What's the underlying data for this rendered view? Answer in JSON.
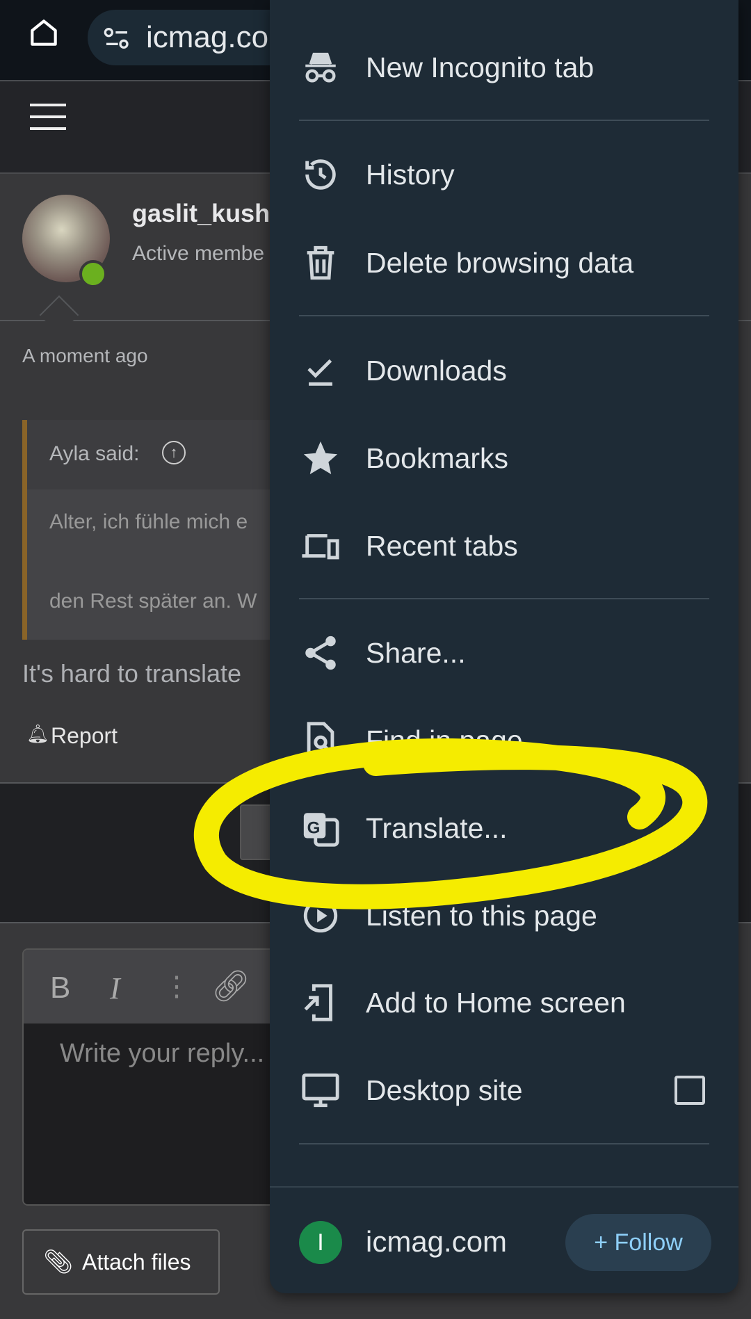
{
  "browser": {
    "url": "icmag.co",
    "home_icon": "home-icon",
    "site_settings_icon": "tune-icon"
  },
  "post": {
    "username": "gaslit_kush",
    "role": "Active membe",
    "time": "A moment ago",
    "quote_author": "Ayla said:",
    "quote_line1": "Alter, ich fühle mich e",
    "quote_line2": "den Rest später an. W",
    "body": "It's hard to translate ",
    "report": "Report",
    "quote_bar_color": "#8a6428",
    "online_color": "#6bb01f"
  },
  "editor": {
    "placeholder": "Write your reply...",
    "bold": "B",
    "italic": "I",
    "more": "⋮",
    "attach": "Attach files"
  },
  "menu": {
    "items": [
      {
        "label": "New Incognito tab",
        "icon": "incognito-icon"
      },
      {
        "label": "History",
        "icon": "history-icon"
      },
      {
        "label": "Delete browsing data",
        "icon": "trash-icon"
      },
      {
        "label": "Downloads",
        "icon": "download-done-icon"
      },
      {
        "label": "Bookmarks",
        "icon": "star-icon"
      },
      {
        "label": "Recent tabs",
        "icon": "devices-icon"
      },
      {
        "label": "Share...",
        "icon": "share-icon"
      },
      {
        "label": "Find in page",
        "icon": "find-in-page-icon"
      },
      {
        "label": "Translate...",
        "icon": "translate-icon"
      },
      {
        "label": "Listen to this page",
        "icon": "play-circle-icon"
      },
      {
        "label": "Add to Home screen",
        "icon": "add-to-home-icon"
      },
      {
        "label": "Desktop site",
        "icon": "monitor-icon",
        "checked": false
      }
    ],
    "footer": {
      "site": "icmag.com",
      "avatar_letter": "I",
      "follow": "Follow",
      "follow_plus": "+",
      "avatar_color": "#1a8a4a",
      "follow_color": "#8ecff8"
    }
  },
  "annotation": {
    "highlight_color": "#f5ec00"
  }
}
